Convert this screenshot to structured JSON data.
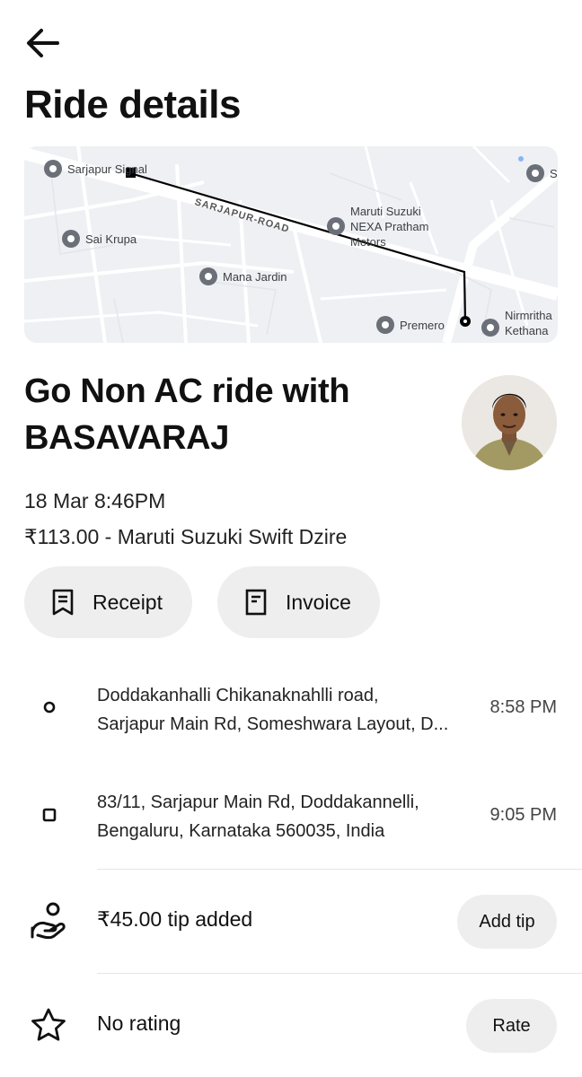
{
  "header": {
    "back_icon": "arrow-left-icon",
    "title": "Ride details"
  },
  "map": {
    "road_label": "SARJAPUR-ROAD",
    "pois": {
      "sarjapur_signal": "Sarjapur Signal",
      "sai_krupa": "Sai Krupa",
      "mana_jardin": "Mana Jardin",
      "maruti_nexa_line1": "Maruti Suzuki",
      "maruti_nexa_line2": "NEXA Pratham",
      "maruti_nexa_line3": "Motors",
      "premero": "Premero",
      "nirmritha_line1": "Nirmritha",
      "nirmritha_line2": "Kethana",
      "partial_right": "S"
    },
    "route_color": "#000000"
  },
  "ride": {
    "title": "Go Non AC ride with BASAVARAJ",
    "datetime": "18 Mar 8:46PM",
    "fare_vehicle": "₹113.00 - Maruti Suzuki Swift Dzire"
  },
  "actions": {
    "receipt_label": "Receipt",
    "receipt_icon": "receipt-icon",
    "invoice_label": "Invoice",
    "invoice_icon": "invoice-icon"
  },
  "stops": [
    {
      "icon": "pickup-circle-icon",
      "line1": "Doddakanhalli Chikanaknahlli road,",
      "line2": "Sarjapur Main Rd, Someshwara Layout, D...",
      "time": "8:58 PM"
    },
    {
      "icon": "dropoff-square-icon",
      "line1": "83/11, Sarjapur Main Rd, Doddakannelli,",
      "line2": "Bengaluru, Karnataka 560035, India",
      "time": "9:05 PM"
    }
  ],
  "tip": {
    "icon": "tip-hand-icon",
    "label": "₹45.00 tip added",
    "button": "Add tip"
  },
  "rating": {
    "icon": "star-icon",
    "label": "No rating",
    "button": "Rate"
  },
  "colors": {
    "background": "#ffffff",
    "pill_background": "#eeeeee",
    "map_background": "#eef0f3",
    "text_primary": "#111111"
  }
}
